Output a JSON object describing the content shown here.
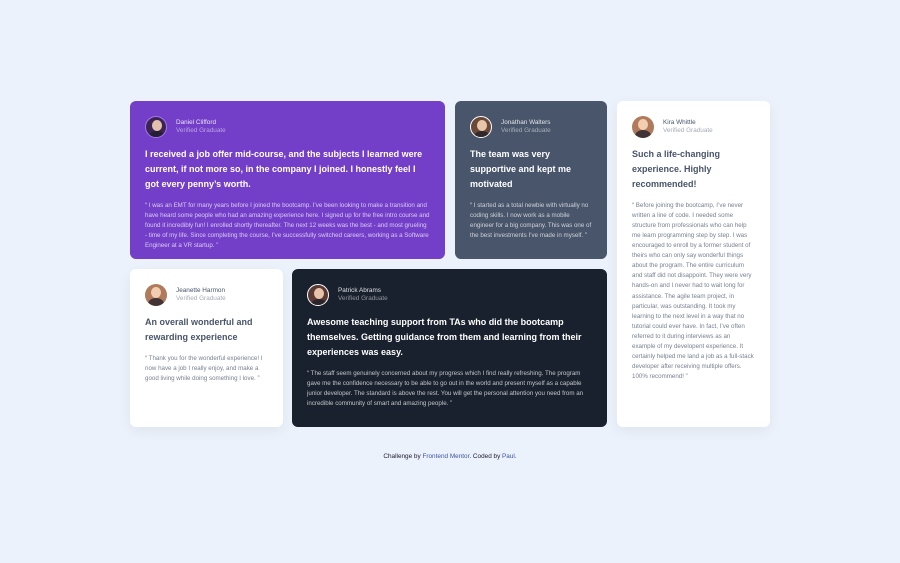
{
  "testimonials": [
    {
      "name": "Daniel Clifford",
      "role": "Verified Graduate",
      "title": "I received a job offer mid-course, and the subjects I learned were current, if not more so, in the company I joined. I honestly feel I got every penny’s worth.",
      "quote": "“ I was an EMT for many years before I joined the bootcamp. I’ve been looking to make a transition and have heard some people who had an amazing experience here. I signed up for the free intro course and found it incredibly fun! I enrolled shortly thereafter. The next 12 weeks was the best - and most grueling - time of my life. Since completing the course, I’ve successfully switched careers, working as a Software Engineer at a VR startup. ”"
    },
    {
      "name": "Jonathan Walters",
      "role": "Verified Graduate",
      "title": "The team was very supportive and kept me motivated",
      "quote": "“ I started as a total newbie with virtually no coding skills. I now work as a mobile engineer for a big company. This was one of the best investments I’ve made in myself. ”"
    },
    {
      "name": "Kira Whittle",
      "role": "Verified Graduate",
      "title": "Such a life-changing experience. Highly recommended!",
      "quote": "“ Before joining the bootcamp, I’ve never written a line of code. I needed some structure from professionals who can help me learn programming step by step. I was encouraged to enroll by a former student of theirs who can only say wonderful things about the program. The entire curriculum and staff did not disappoint. They were very hands-on and I never had to wait long for assistance. The agile team project, in particular, was outstanding. It took my learning to the next level in a way that no tutorial could ever have. In fact, I’ve often referred to it during interviews as an example of my developent experience. It certainly helped me land a job as a full-stack developer after receiving multiple offers. 100% recommend! ”"
    },
    {
      "name": "Jeanette Harmon",
      "role": "Verified Graduate",
      "title": "An overall wonderful and rewarding experience",
      "quote": "“ Thank you for the wonderful experience! I now have a job I really enjoy, and make a good living while doing something I love. ”"
    },
    {
      "name": "Patrick Abrams",
      "role": "Verified Graduate",
      "title": "Awesome teaching support from TAs who did the bootcamp themselves. Getting guidance from them and learning from their experiences was easy.",
      "quote": "“ The staff seem genuinely concerned about my progress which I find really refreshing. The program gave me the confidence necessary to be able to go out in the world and present myself as a capable junior developer. The standard is above the rest. You will get the personal attention you need from an incredible community of smart and amazing people. ”"
    }
  ],
  "footer": {
    "prefix": "Challenge by ",
    "link1": "Frontend Mentor",
    "middle": ". Coded by ",
    "link2": "Paul",
    "suffix": "."
  },
  "colors": {
    "background": "#ecf2fb",
    "purple": "#733fc8",
    "slate": "#48556a",
    "white": "#ffffff",
    "dark": "#19212e",
    "link": "#3e52a3"
  },
  "icons": [
    "avatar-daniel",
    "avatar-jonathan",
    "avatar-kira",
    "avatar-jeanette",
    "avatar-patrick"
  ]
}
